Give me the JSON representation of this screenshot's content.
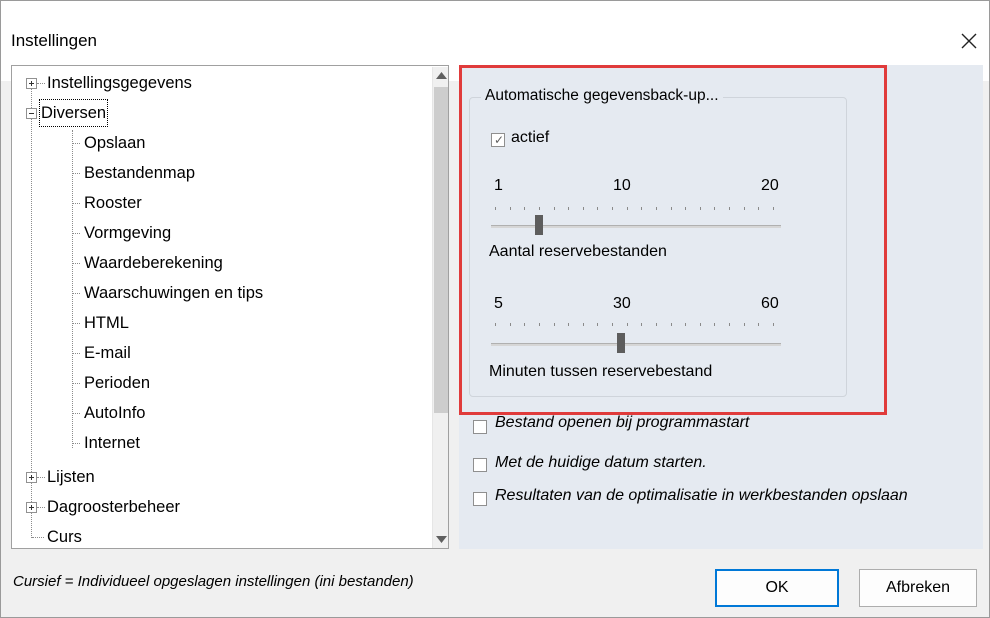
{
  "window": {
    "title": "Instellingen"
  },
  "tree": {
    "items": [
      {
        "label": "Instellingsgegevens",
        "level": 0,
        "expander": "plus"
      },
      {
        "label": "Diversen",
        "level": 0,
        "expander": "minus",
        "selected": true
      },
      {
        "label": "Opslaan",
        "level": 1
      },
      {
        "label": "Bestandenmap",
        "level": 1
      },
      {
        "label": "Rooster",
        "level": 1
      },
      {
        "label": "Vormgeving",
        "level": 1
      },
      {
        "label": "Waardeberekening",
        "level": 1
      },
      {
        "label": "Waarschuwingen en tips",
        "level": 1
      },
      {
        "label": "HTML",
        "level": 1
      },
      {
        "label": "E-mail",
        "level": 1
      },
      {
        "label": "Perioden",
        "level": 1
      },
      {
        "label": "AutoInfo",
        "level": 1
      },
      {
        "label": "Internet",
        "level": 1
      },
      {
        "label": "Lijsten",
        "level": 0,
        "expander": "plus"
      },
      {
        "label": "Dagroosterbeheer",
        "level": 0,
        "expander": "plus"
      },
      {
        "label": "Curs",
        "level": 0
      }
    ]
  },
  "backup": {
    "group_title": "Automatische gegevensback-up...",
    "active_label": "actief",
    "active_checked": true,
    "slider1": {
      "min_label": "1",
      "mid_label": "10",
      "max_label": "20",
      "value": 4,
      "caption": "Aantal reservebestanden"
    },
    "slider2": {
      "min_label": "5",
      "mid_label": "30",
      "max_label": "60",
      "value": 30,
      "caption": "Minuten tussen reservebestand"
    }
  },
  "options": [
    {
      "label": "Bestand openen bij programmastart",
      "checked": false
    },
    {
      "label": "Met de huidige datum starten.",
      "checked": false
    },
    {
      "label": "Resultaten van de optimalisatie in werkbestanden opslaan",
      "checked": false
    }
  ],
  "footer": {
    "note": "Cursief = Individueel opgeslagen instellingen (ini bestanden)",
    "ok_label": "OK",
    "cancel_label": "Afbreken"
  },
  "colors": {
    "highlight": "#e03b3b",
    "panel_bg": "#e5eaf1",
    "ok_border": "#0078d7"
  },
  "icons": [
    "close-icon",
    "scroll-up-arrow-icon",
    "scroll-down-arrow-icon",
    "checkmark-icon"
  ]
}
